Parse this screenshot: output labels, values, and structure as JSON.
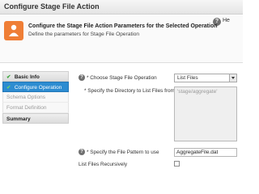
{
  "window": {
    "title": "Configure Stage File Action"
  },
  "header": {
    "title": "Configure the Stage File Action Parameters for the Selected Operation",
    "subtitle": "Define the parameters for Stage File Operation",
    "help_label": "He",
    "accent_color": "#ef7e36"
  },
  "sidebar": {
    "items": [
      {
        "label": "Basic Info",
        "state": "completed"
      },
      {
        "label": "Configure Operation",
        "state": "active"
      },
      {
        "label": "Schema Options",
        "state": "disabled"
      },
      {
        "label": "Format Definition",
        "state": "disabled"
      },
      {
        "label": "Summary",
        "state": "section"
      }
    ]
  },
  "form": {
    "operation": {
      "label": "* Choose Stage File Operation",
      "value": "List Files"
    },
    "directory": {
      "label": "* Specify the Directory to List Files from",
      "value": "'stage/aggregate'"
    },
    "pattern": {
      "label": "* Specify the File Pattern to use",
      "value": "AggregateFile.dat"
    },
    "recursive": {
      "label": "List Files Recursively",
      "checked": false
    }
  }
}
